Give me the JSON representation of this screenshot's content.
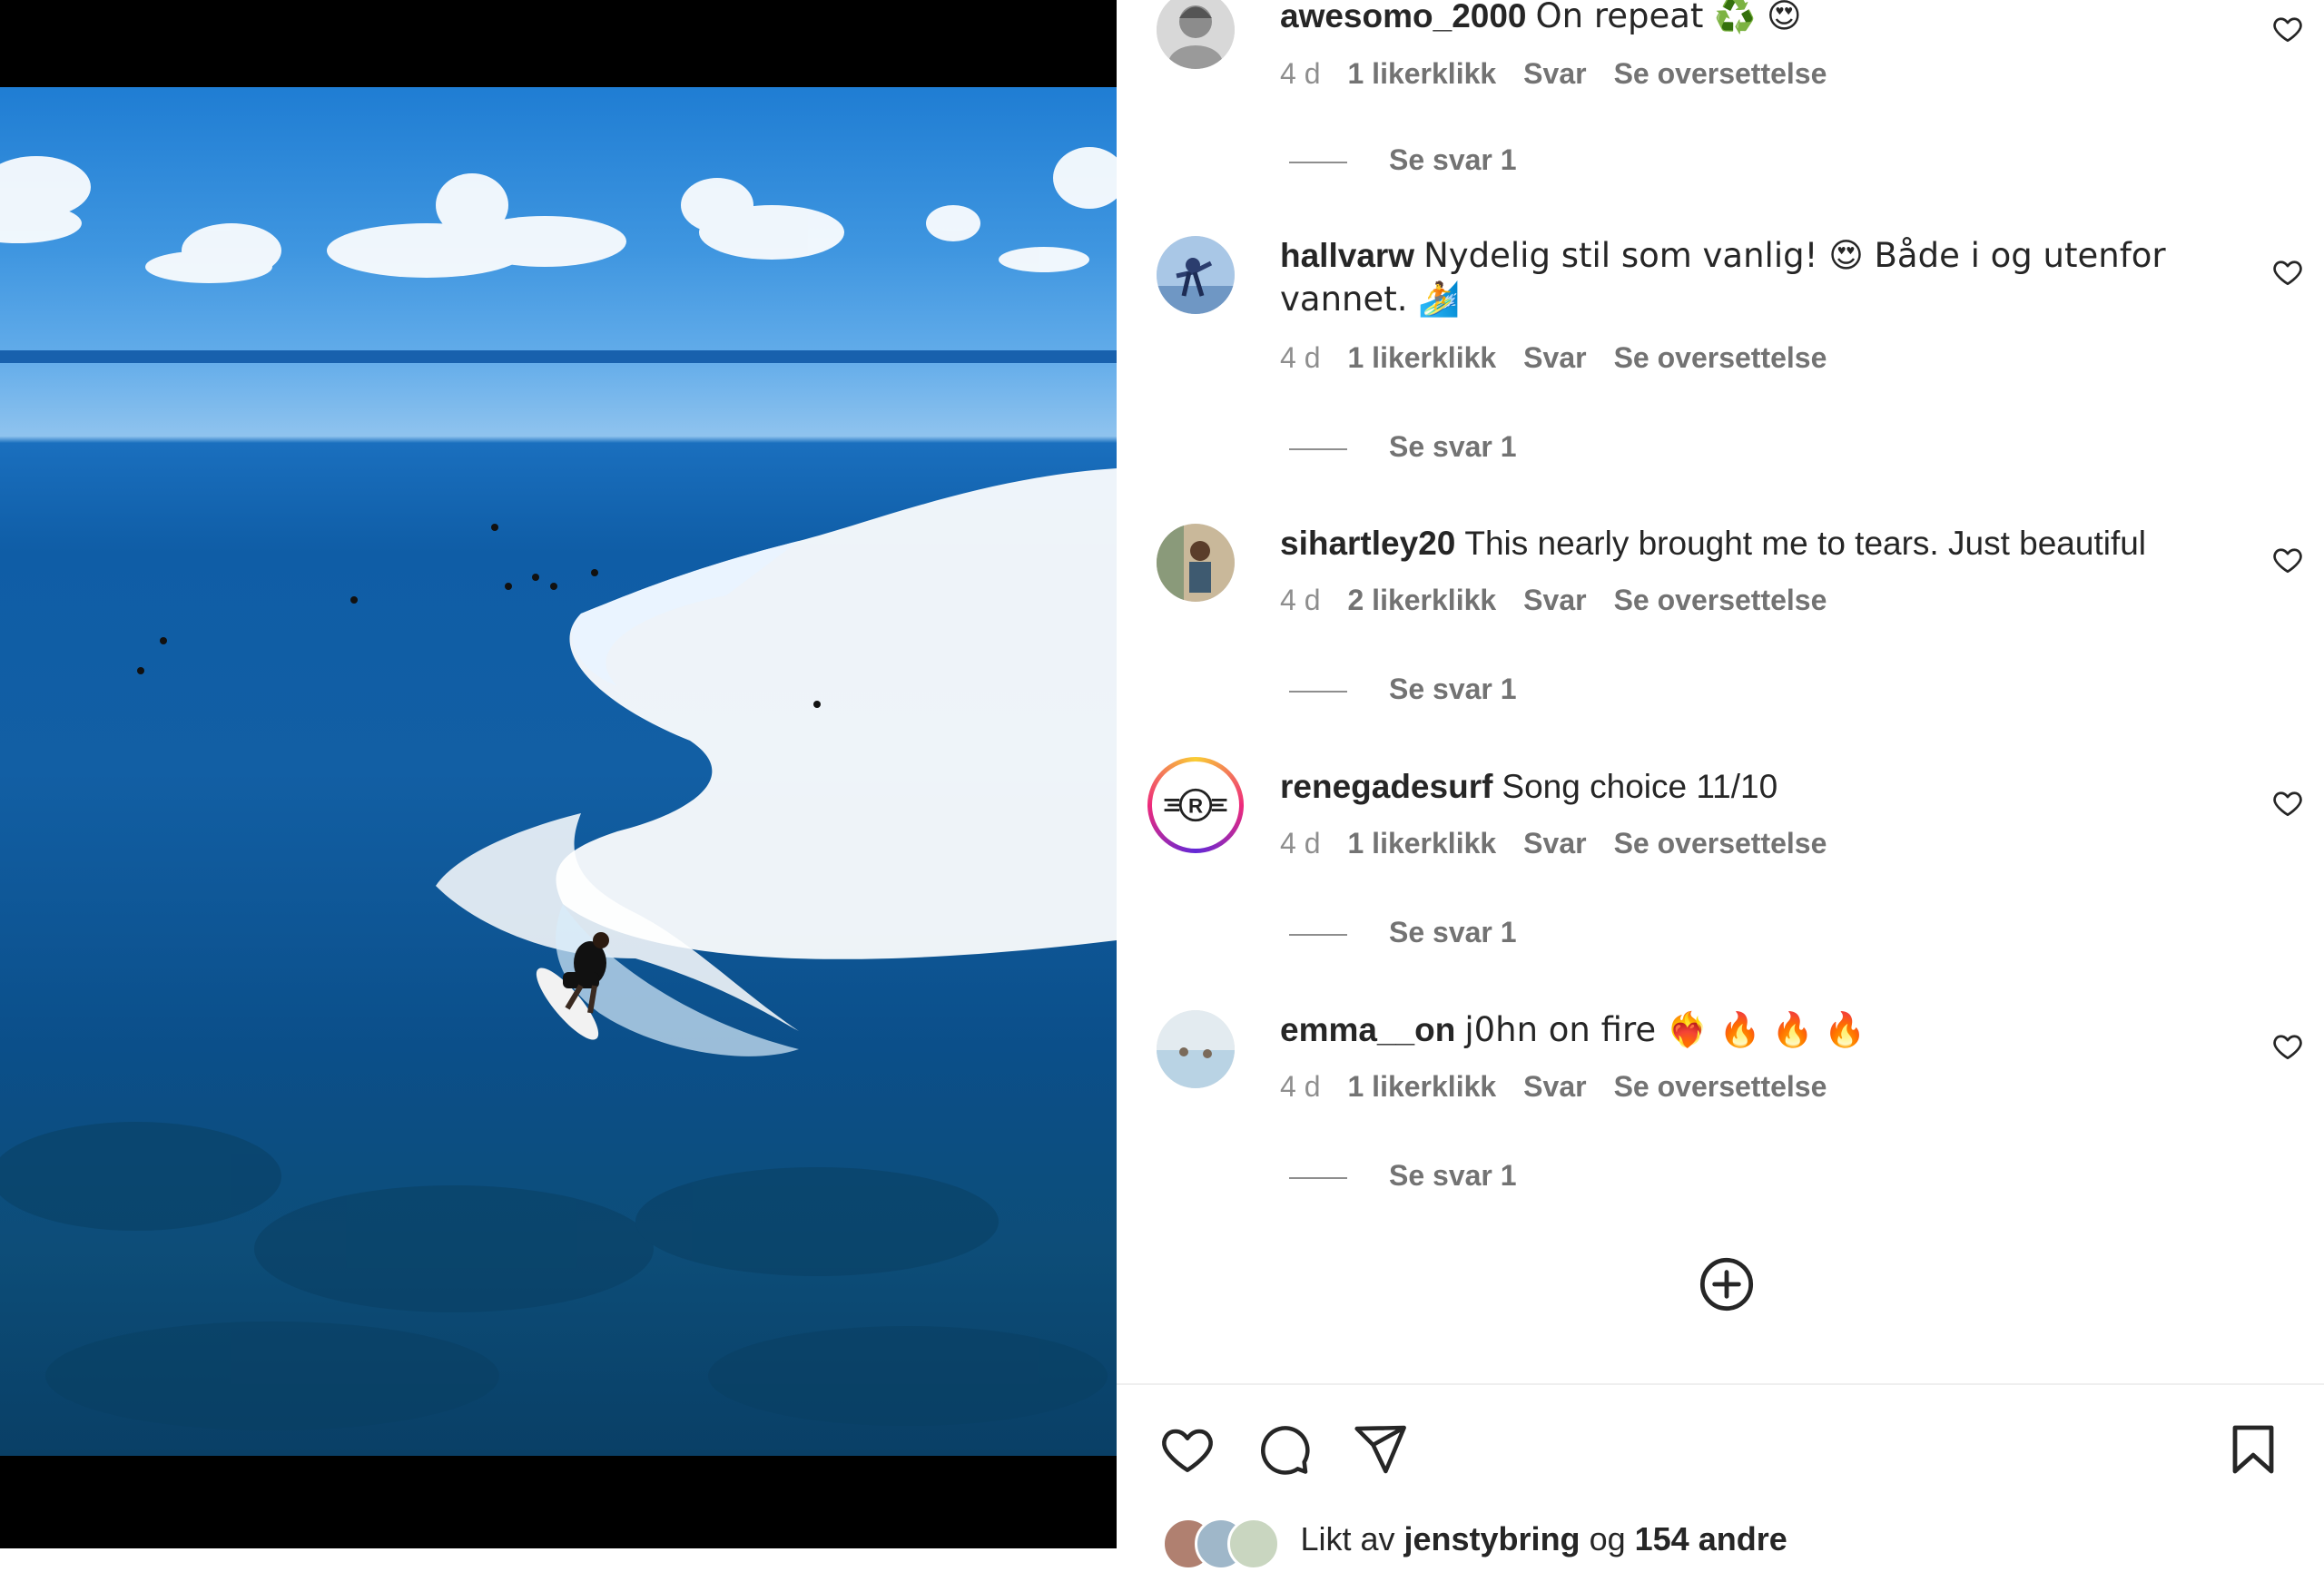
{
  "post": {
    "video_subject": "Drone view of a surfer riding a wave over a reef"
  },
  "comments": [
    {
      "username": "awesomo_2000",
      "text": "On repeat ♻️ 😍",
      "time": "4 d",
      "likes": "1 likerklikk",
      "reply": "Svar",
      "translate": "Se oversettelse",
      "view_replies": "Se svar 1"
    },
    {
      "username": "hallvarw",
      "text": "Nydelig stil som vanlig! 😍 Både i og utenfor vannet. 🏄",
      "time": "4 d",
      "likes": "1 likerklikk",
      "reply": "Svar",
      "translate": "Se oversettelse",
      "view_replies": "Se svar 1"
    },
    {
      "username": "sihartley20",
      "text": "This nearly brought me to tears. Just beautiful",
      "time": "4 d",
      "likes": "2 likerklikk",
      "reply": "Svar",
      "translate": "Se oversettelse",
      "view_replies": "Se svar 1"
    },
    {
      "username": "renegadesurf",
      "text": "Song choice 11/10",
      "time": "4 d",
      "likes": "1 likerklikk",
      "reply": "Svar",
      "translate": "Se oversettelse",
      "view_replies": "Se svar 1"
    },
    {
      "username": "emma__on",
      "text": "j0hn on fire ❤️‍🔥 🔥 🔥 🔥",
      "time": "4 d",
      "likes": "1 likerklikk",
      "reply": "Svar",
      "translate": "Se oversettelse",
      "view_replies": "Se svar 1"
    }
  ],
  "liked_by": {
    "prefix": "Likt av",
    "user": "jenstybring",
    "connector": "og",
    "others": "154 andre"
  },
  "icons": {
    "comment_like": "heart-outline-icon",
    "load_more": "plus-circle-icon",
    "like": "heart-icon",
    "comment": "speech-bubble-icon",
    "share": "paper-plane-icon",
    "save": "bookmark-icon"
  },
  "colors": {
    "text": "#262626",
    "secondary": "#8e8e8e",
    "divider": "#efefef"
  }
}
